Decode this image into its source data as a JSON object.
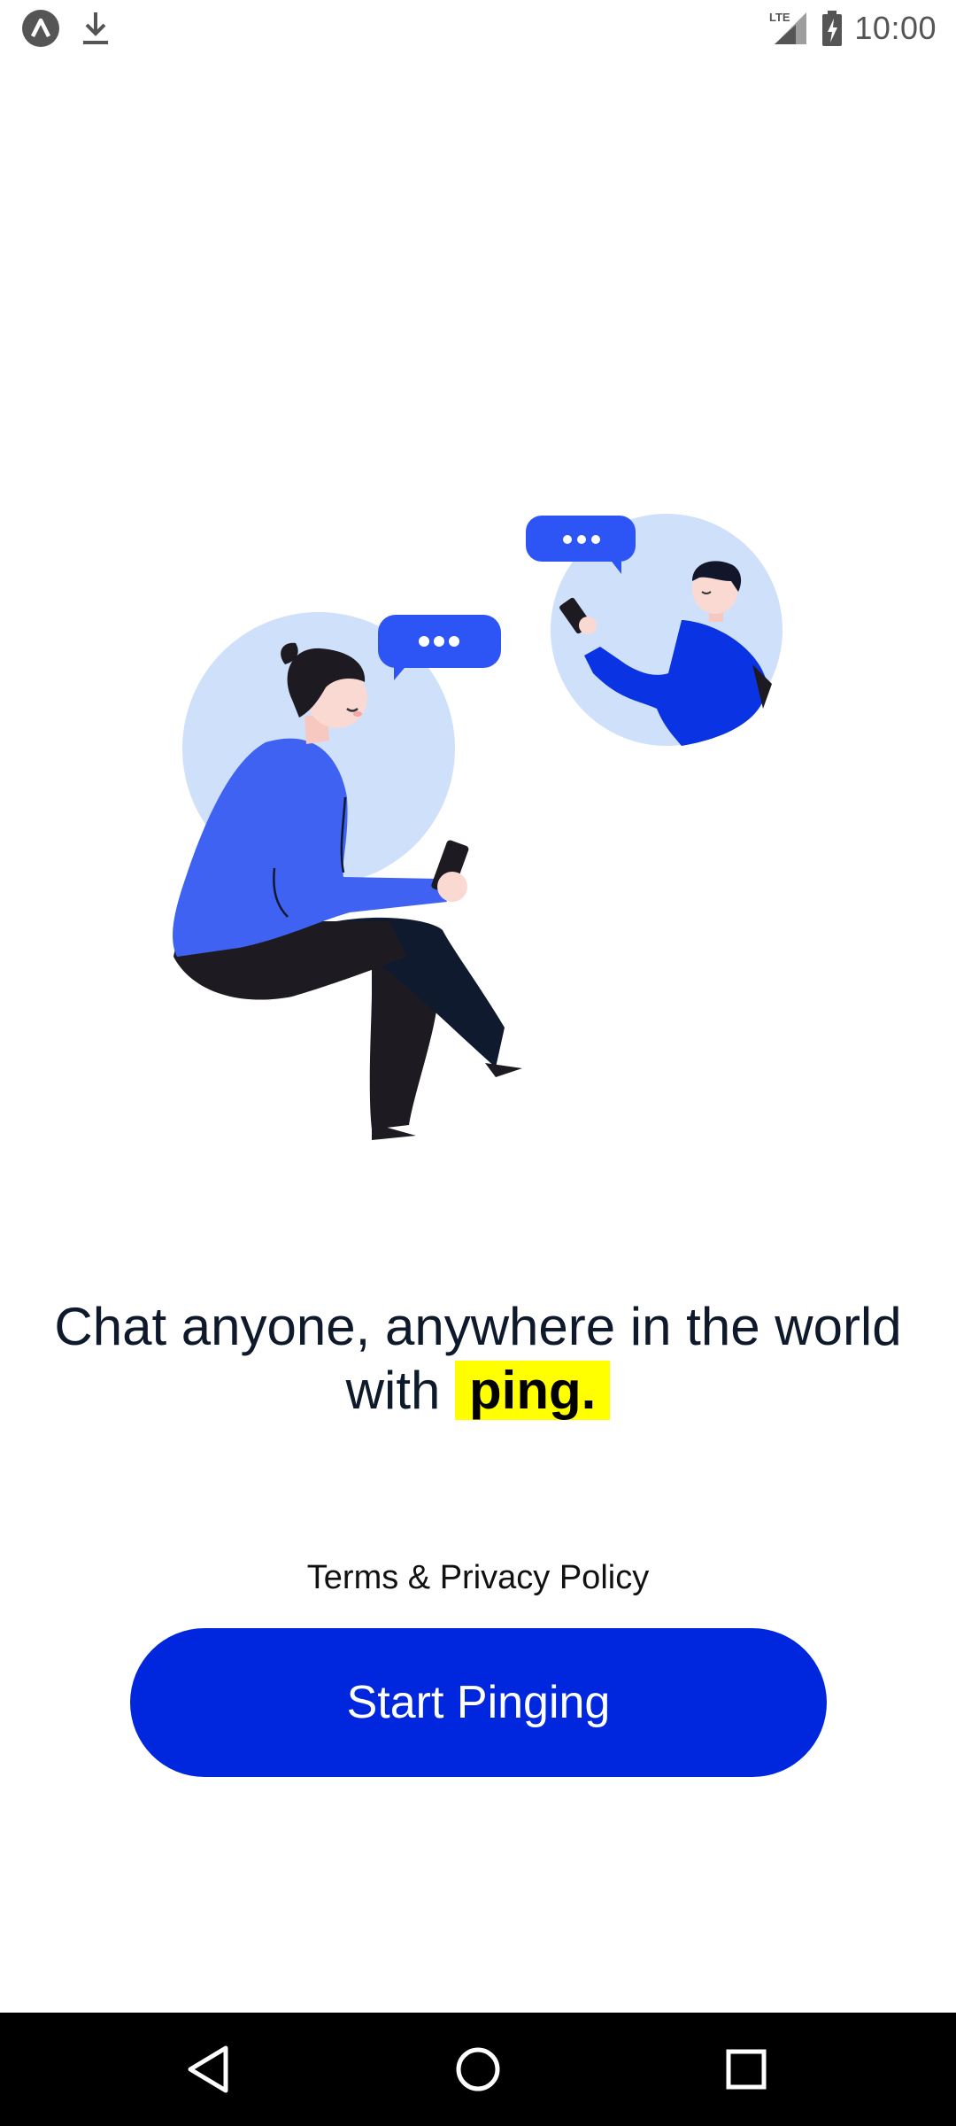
{
  "status_bar": {
    "time": "10:00",
    "left_icons": [
      "app-logo-icon",
      "download-icon"
    ],
    "right_icons": [
      "lte-signal-icon",
      "battery-charging-icon"
    ],
    "network_label": "LTE"
  },
  "illustration": {
    "description_icons": [
      "person-sitting-with-phone",
      "person-in-circle-with-phone",
      "chat-bubble-icon"
    ],
    "colors": {
      "primary_blue": "#3f62f3",
      "light_circle": "#cfe0fb",
      "bubble_blue": "#2d55f5",
      "dark_pants": "#1e1a22"
    }
  },
  "headline": {
    "line1": "Chat anyone, anywhere in the world",
    "line2_prefix": "with",
    "brand": "ping."
  },
  "terms_link": "Terms & Privacy Policy",
  "start_button_label": "Start Pinging",
  "colors": {
    "accent": "#0027de",
    "highlight": "#ffff00",
    "text": "#0e1a2b"
  },
  "nav_bar": {
    "icons": [
      "back-icon",
      "home-icon",
      "recents-icon"
    ]
  }
}
